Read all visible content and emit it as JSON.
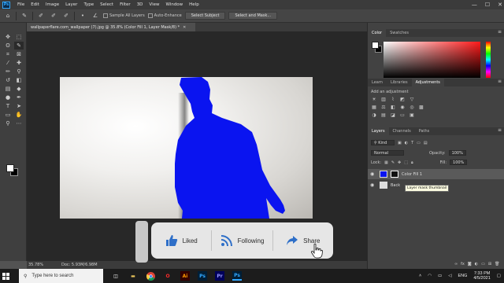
{
  "menubar": {
    "logo": "Ps",
    "items": [
      "File",
      "Edit",
      "Image",
      "Layer",
      "Type",
      "Select",
      "Filter",
      "3D",
      "View",
      "Window",
      "Help"
    ],
    "window_controls": [
      "—",
      "☐",
      "✕"
    ]
  },
  "options_bar": {
    "sample_all_layers": "Sample All Layers",
    "auto_enhance": "Auto-Enhance",
    "select_subject": "Select Subject",
    "select_and_mask": "Select and Mask..."
  },
  "document": {
    "tab_title": "wallpaperflare.com_wallpaper (7).jpg @ 35.8% (Color Fill 1, Layer Mask/8) *",
    "close": "✕",
    "fill_color": "#0a14f0"
  },
  "status": {
    "zoom": "35.78%",
    "doc_size": "Doc: 5.93M/6.98M"
  },
  "panels": {
    "color_tabs": [
      "Color",
      "Swatches"
    ],
    "adjust_tabs": [
      "Learn",
      "Libraries",
      "Adjustments"
    ],
    "add_adjustment": "Add an adjustment",
    "layers_tabs": [
      "Layers",
      "Channels",
      "Paths"
    ],
    "kind": "Kind",
    "blend_mode": "Normal",
    "opacity_label": "Opacity:",
    "opacity_value": "100%",
    "lock_label": "Lock:",
    "fill_label": "Fill:",
    "fill_value": "100%",
    "layers": [
      {
        "name": "Color Fill 1"
      },
      {
        "name": "Back"
      }
    ],
    "tooltip": "Layer mask thumbnail"
  },
  "overlay": {
    "liked": "Liked",
    "following": "Following",
    "share": "Share"
  },
  "taskbar": {
    "search_placeholder": "Type here to search",
    "language": "ENG",
    "time": "7:33 PM",
    "date": "4/5/2021",
    "apps": [
      {
        "name": "Ai",
        "color": "#ff9a00"
      },
      {
        "name": "Ps",
        "color": "#31a8ff"
      },
      {
        "name": "Pr",
        "color": "#9999ff"
      },
      {
        "name": "Ps",
        "color": "#31a8ff"
      }
    ]
  }
}
